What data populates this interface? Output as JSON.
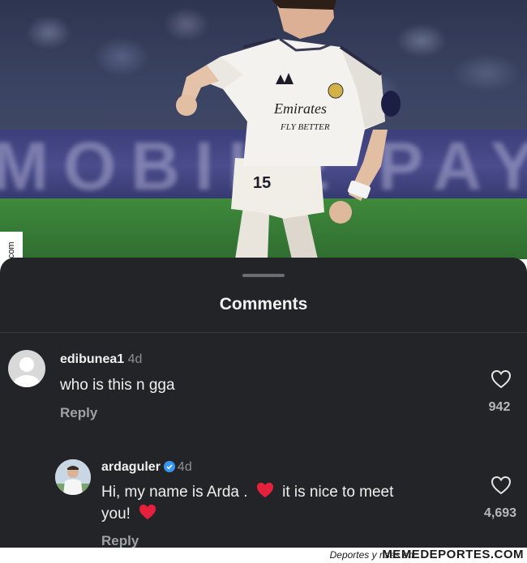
{
  "photo": {
    "banner_text": "MOBILE PAY",
    "jersey_sponsor_line1": "Emirates",
    "jersey_sponsor_line2": "FLY BETTER",
    "shirt_number": "15"
  },
  "watermark": {
    "side_text": "Memedeportes.com",
    "footer_small": "Deportes y risas en",
    "footer_brand": "MEMEDEPORTES.COM"
  },
  "sheet": {
    "title": "Comments"
  },
  "comments": [
    {
      "username": "edibunea1",
      "time": "4d",
      "text": "who is this n gga",
      "reply_label": "Reply",
      "like_count": "942"
    },
    {
      "username": "ardaguler",
      "time": "4d",
      "verified": true,
      "text_part1": "Hi, my name is Arda .",
      "text_part2": "it is nice to meet",
      "text_part3": "you!",
      "reply_label": "Reply",
      "like_count": "4,693"
    }
  ],
  "colors": {
    "sheet_bg": "#232427",
    "verified_blue": "#3797f0",
    "heart_red": "#e5203a"
  }
}
